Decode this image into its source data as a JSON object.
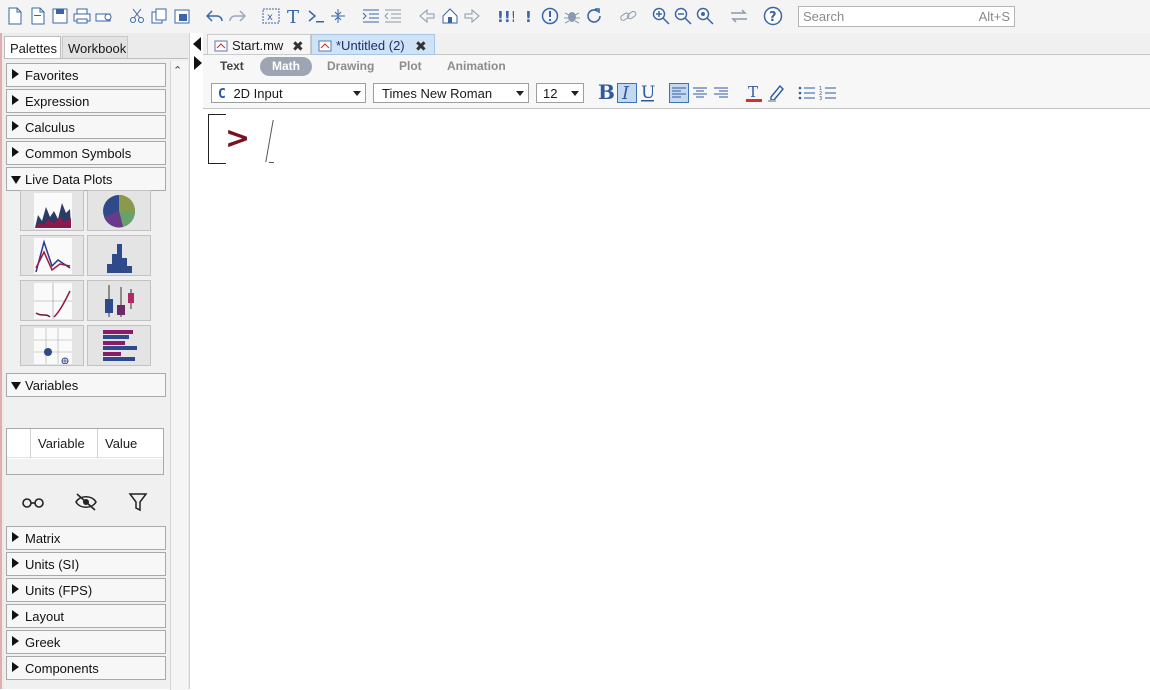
{
  "toolbar": {
    "search_placeholder": "Search",
    "search_shortcut": "Alt+S"
  },
  "left_panel": {
    "tabs": [
      "Palettes",
      "Workbook"
    ],
    "palettes": [
      {
        "label": "Favorites",
        "expanded": false
      },
      {
        "label": "Expression",
        "expanded": false
      },
      {
        "label": "Calculus",
        "expanded": false
      },
      {
        "label": "Common Symbols",
        "expanded": false
      },
      {
        "label": "Live Data Plots",
        "expanded": true
      },
      {
        "label": "Variables",
        "expanded": true
      },
      {
        "label": "Matrix",
        "expanded": false
      },
      {
        "label": "Units (SI)",
        "expanded": false
      },
      {
        "label": "Units (FPS)",
        "expanded": false
      },
      {
        "label": "Layout",
        "expanded": false
      },
      {
        "label": "Greek",
        "expanded": false
      },
      {
        "label": "Components",
        "expanded": false
      }
    ],
    "live_data_plots": [
      "area-plot-icon",
      "pie-chart-icon",
      "line-plot-icon",
      "histogram-icon",
      "curve-plot-icon",
      "box-plot-icon",
      "point-plot-icon",
      "bar-chart-icon"
    ],
    "variables_table": {
      "columns": [
        "Variable",
        "Value"
      ]
    },
    "variables_icons": [
      "show-variables-icon",
      "hide-variables-icon",
      "filter-icon"
    ]
  },
  "document": {
    "tabs": [
      {
        "label": "Start.mw",
        "active": false
      },
      {
        "label": "*Untitled (2)",
        "active": true
      }
    ],
    "modes": [
      "Text",
      "Math",
      "Drawing",
      "Plot",
      "Animation"
    ],
    "active_mode": "Math",
    "input_style": "2D Input",
    "input_style_prefix": "C",
    "font_family": "Times New Roman",
    "font_size": "12",
    "prompt": ">"
  },
  "colors": {
    "prompt": "#7a1020",
    "active_tab": "#cfe3f7",
    "math_pill": "#9ea5b2",
    "icon_blue": "#3a66a8"
  }
}
